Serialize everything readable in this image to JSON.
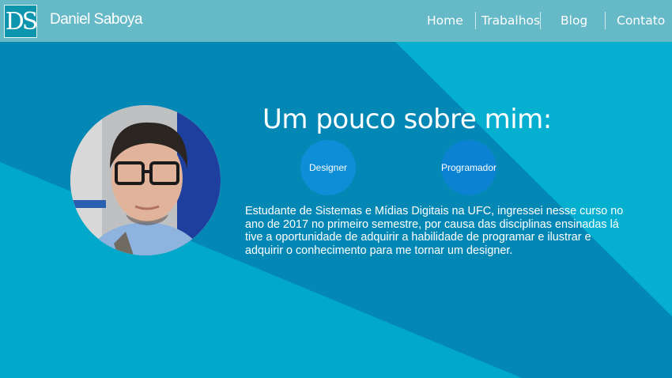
{
  "header": {
    "logo_text": "DS",
    "brand_name": "Daniel Saboya",
    "nav": [
      {
        "label": "Home"
      },
      {
        "label": "Trabalhos"
      },
      {
        "label": "Blog"
      },
      {
        "label": "Contato"
      }
    ]
  },
  "main": {
    "title": "Um pouco sobre mim:",
    "badges": [
      {
        "label": "Designer"
      },
      {
        "label": "Programador"
      }
    ],
    "about_text": "Estudante de Sistemas e Mídias Digitais na UFC, ingressei nesse curso no ano de 2017 no primeiro semestre, por causa das disciplinas ensinadas lá tive a oportunidade de adquirir a habilidade de programar e ilustrar e adquirir o conhecimento para me tornar um designer."
  },
  "colors": {
    "header_bg": "#66b9c6",
    "page_bg": "#02a5c6",
    "diagonal_band": "#0388b6",
    "badge_designer": "#0d8ed6",
    "badge_programmer": "#0b83d2"
  },
  "icons": {
    "profile_photo": "person-photo"
  }
}
